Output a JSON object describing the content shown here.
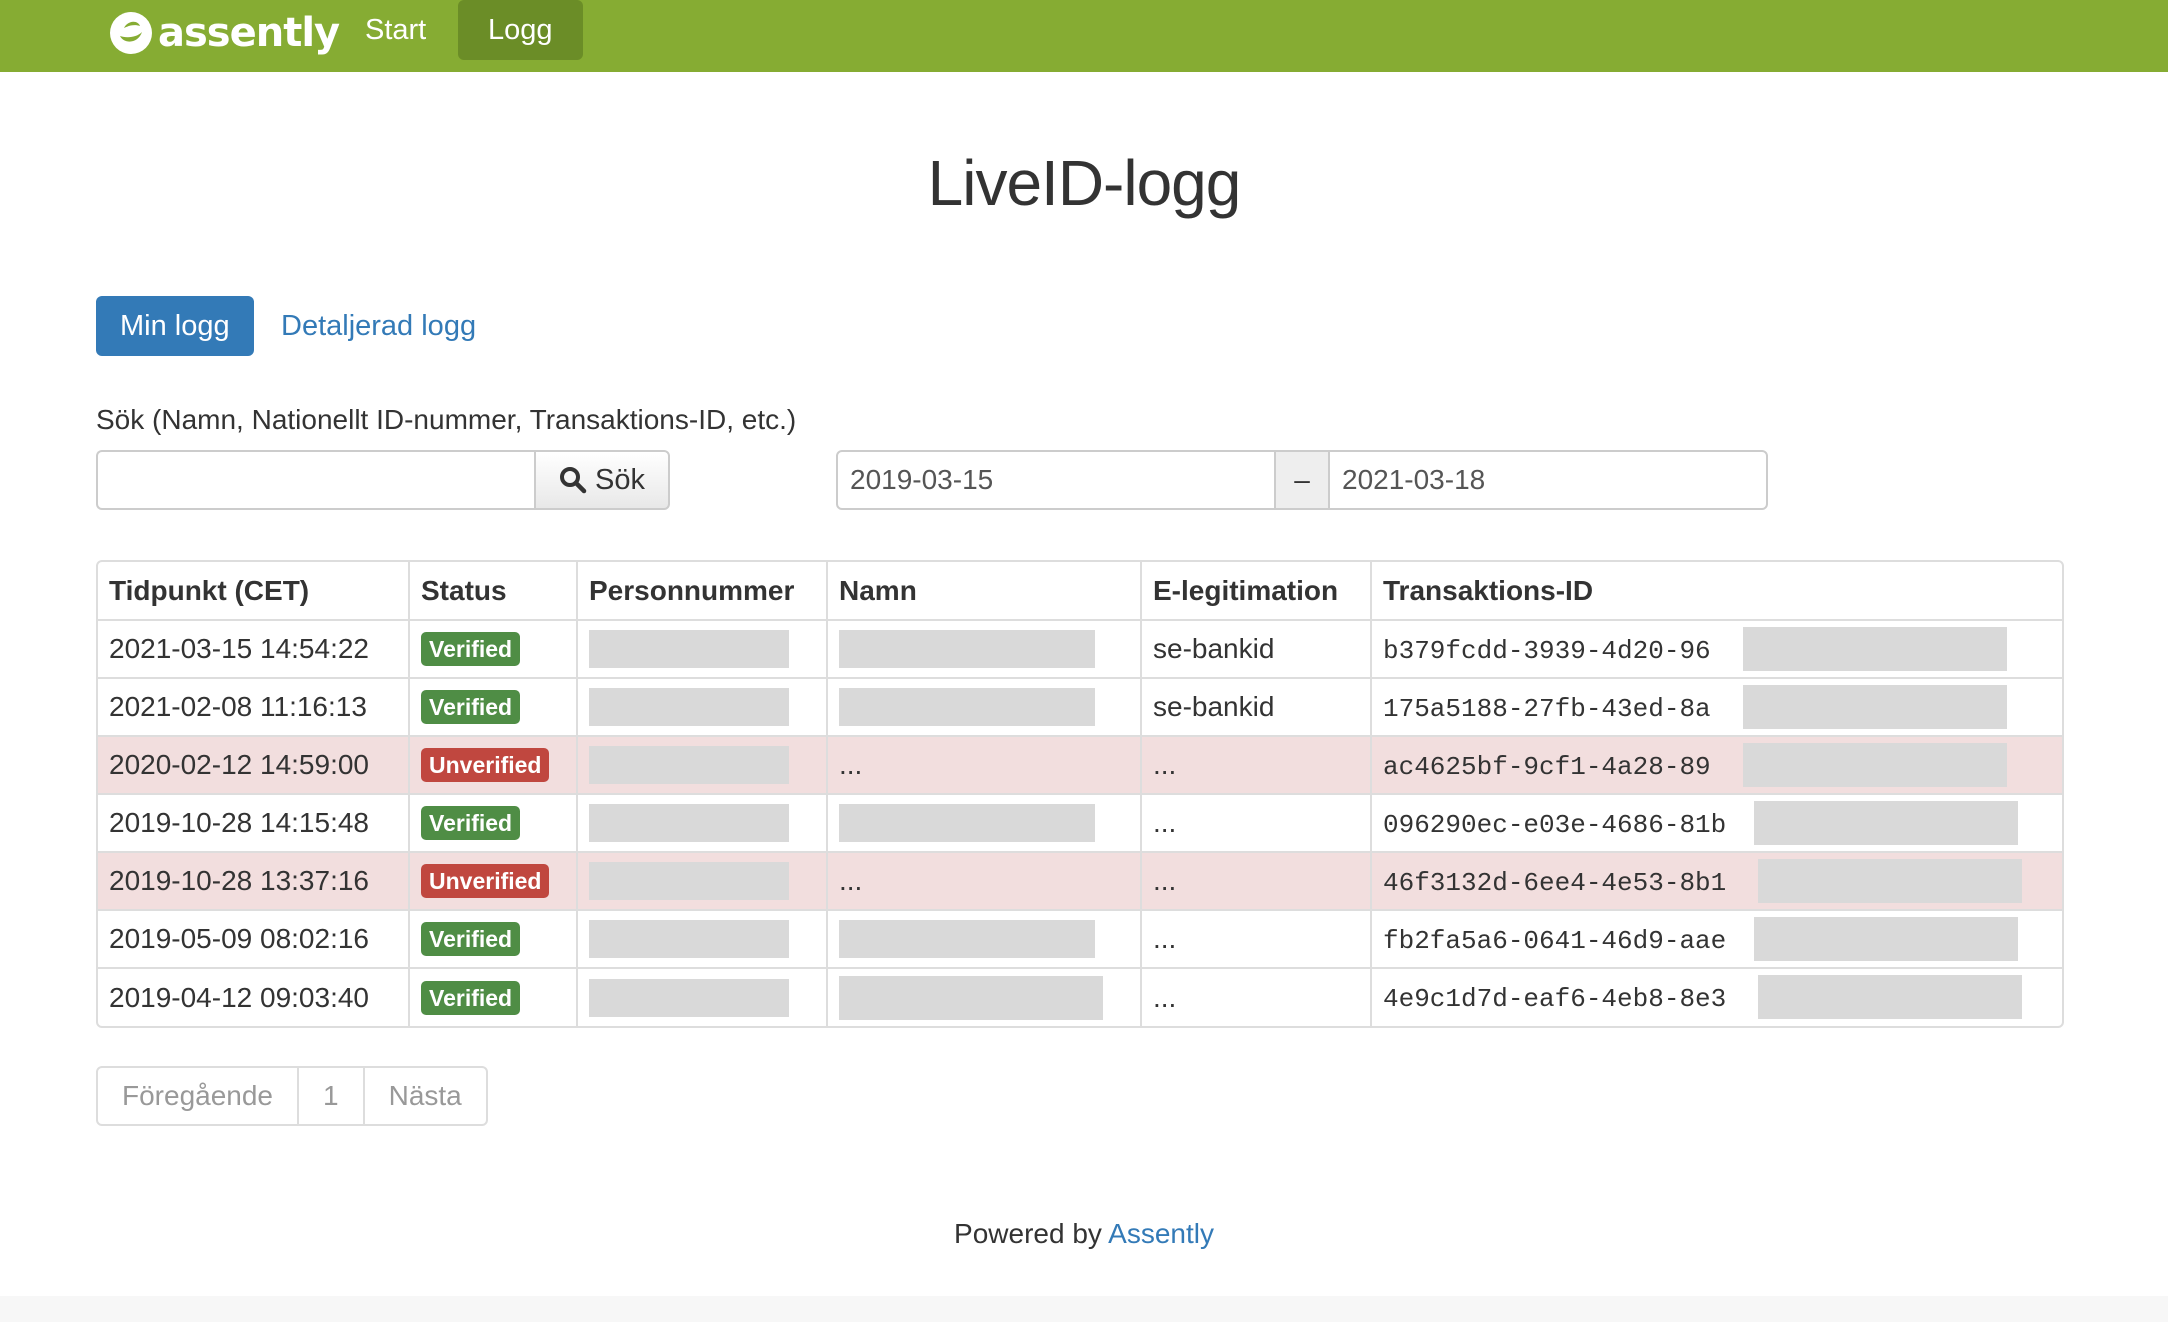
{
  "nav": {
    "brand": "assently",
    "items": [
      {
        "label": "Start"
      },
      {
        "label": "Logg",
        "active": true
      }
    ]
  },
  "page_title": "LiveID-logg",
  "tabs": {
    "min_logg": "Min logg",
    "detaljerad_logg": "Detaljerad logg"
  },
  "search": {
    "label": "Sök (Namn, Nationellt ID-nummer, Transaktions-ID, etc.)",
    "value": "",
    "button_label": "Sök",
    "button_icon": "search-icon"
  },
  "date_range": {
    "from": "2019-03-15",
    "separator": "–",
    "to": "2021-03-18"
  },
  "table": {
    "columns": [
      "Tidpunkt (CET)",
      "Status",
      "Personnummer",
      "Namn",
      "E-legitimation",
      "Transaktions-ID"
    ],
    "rows": [
      {
        "time": "2021-03-15 14:54:22",
        "status": "Verified",
        "personnummer": "",
        "namn": "",
        "elegitimation": "se-bankid",
        "transaction_id": "b379fcdd-3939-4d20-96"
      },
      {
        "time": "2021-02-08 11:16:13",
        "status": "Verified",
        "personnummer": "",
        "namn": "",
        "elegitimation": "se-bankid",
        "transaction_id": "175a5188-27fb-43ed-8a"
      },
      {
        "time": "2020-02-12 14:59:00",
        "status": "Unverified",
        "personnummer": "",
        "namn": "...",
        "elegitimation": "...",
        "transaction_id": "ac4625bf-9cf1-4a28-89"
      },
      {
        "time": "2019-10-28 14:15:48",
        "status": "Verified",
        "personnummer": "",
        "namn": "",
        "elegitimation": "...",
        "transaction_id": "096290ec-e03e-4686-81b"
      },
      {
        "time": "2019-10-28 13:37:16",
        "status": "Unverified",
        "personnummer": "",
        "namn": "...",
        "elegitimation": "...",
        "transaction_id": "46f3132d-6ee4-4e53-8b1"
      },
      {
        "time": "2019-05-09 08:02:16",
        "status": "Verified",
        "personnummer": "",
        "namn": "",
        "elegitimation": "...",
        "transaction_id": "fb2fa5a6-0641-46d9-aae"
      },
      {
        "time": "2019-04-12 09:03:40",
        "status": "Verified",
        "personnummer": "",
        "namn": "",
        "elegitimation": "...",
        "transaction_id": "4e9c1d7d-eaf6-4eb8-8e3"
      }
    ]
  },
  "pagination": {
    "previous": "Föregående",
    "current": "1",
    "next": "Nästa"
  },
  "footer": {
    "prefix": "Powered by",
    "link": "Assently"
  },
  "colors": {
    "navbar": "#86ac33",
    "primary": "#337ab7",
    "verified": "#4f8d45",
    "unverified": "#c0473f",
    "unverified_row": "#f2dede"
  }
}
